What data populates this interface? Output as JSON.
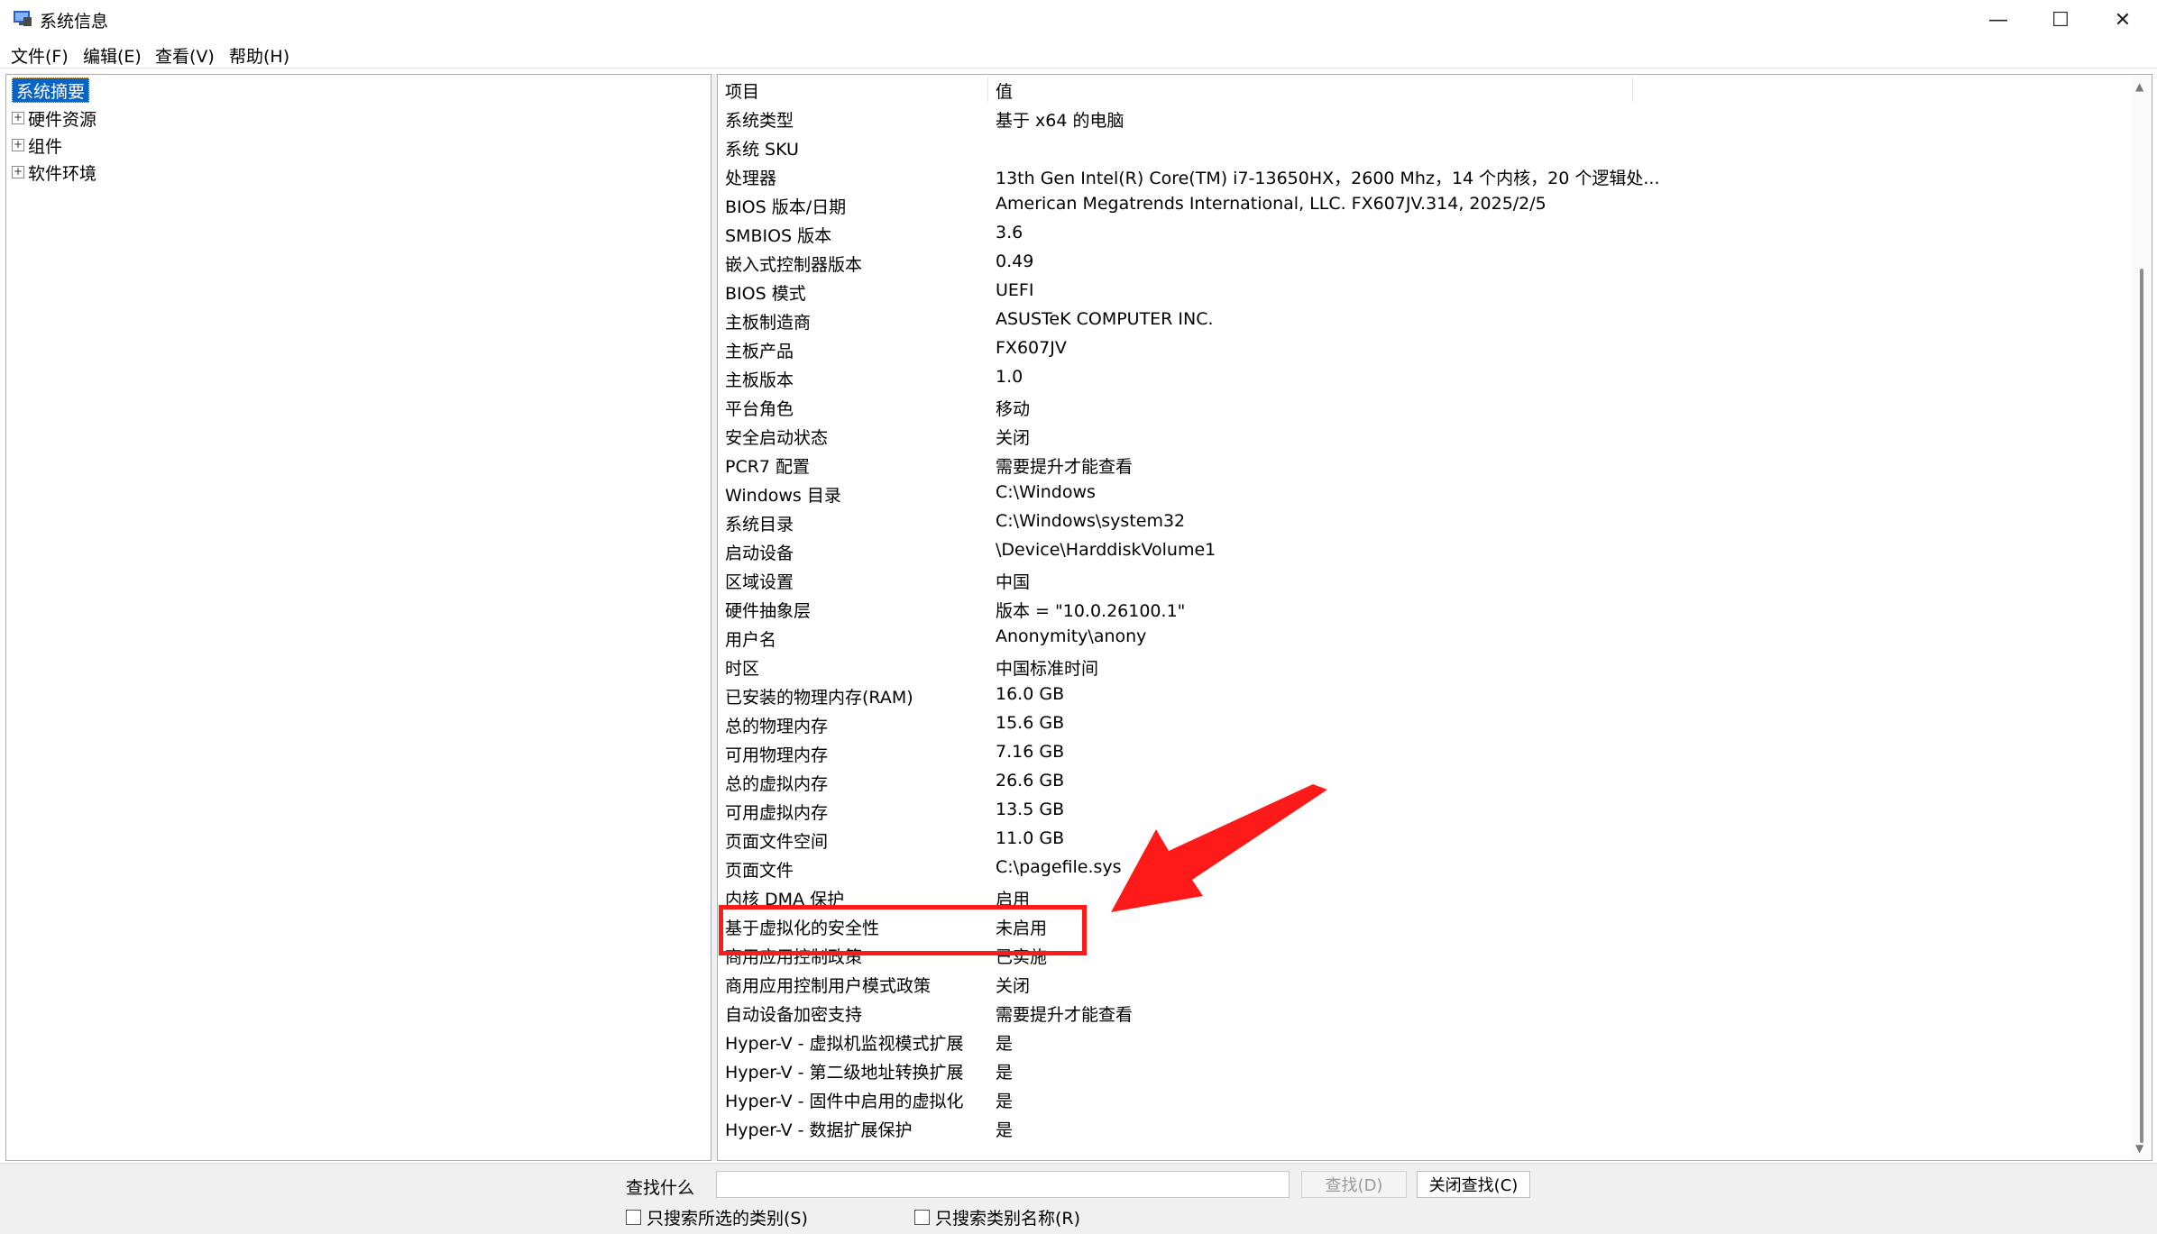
{
  "window": {
    "title": "系统信息",
    "controls": {
      "minimize": "—",
      "maximize": "☐",
      "close": "✕"
    }
  },
  "menu": [
    "文件(F)",
    "编辑(E)",
    "查看(V)",
    "帮助(H)"
  ],
  "tree": [
    {
      "label": "系统摘要",
      "selected": true,
      "expandable": false
    },
    {
      "label": "硬件资源",
      "selected": false,
      "expandable": true
    },
    {
      "label": "组件",
      "selected": false,
      "expandable": true
    },
    {
      "label": "软件环境",
      "selected": false,
      "expandable": true
    }
  ],
  "table": {
    "headers": {
      "key": "项目",
      "value": "值"
    },
    "rows": [
      {
        "key": "系统类型",
        "value": "基于 x64 的电脑"
      },
      {
        "key": "系统 SKU",
        "value": ""
      },
      {
        "key": "处理器",
        "value": "13th Gen Intel(R) Core(TM) i7-13650HX，2600 Mhz，14 个内核，20 个逻辑处..."
      },
      {
        "key": "BIOS 版本/日期",
        "value": "American Megatrends International, LLC. FX607JV.314, 2025/2/5"
      },
      {
        "key": "SMBIOS 版本",
        "value": "3.6"
      },
      {
        "key": "嵌入式控制器版本",
        "value": "0.49"
      },
      {
        "key": "BIOS 模式",
        "value": "UEFI"
      },
      {
        "key": "主板制造商",
        "value": "ASUSTeK COMPUTER INC."
      },
      {
        "key": "主板产品",
        "value": "FX607JV"
      },
      {
        "key": "主板版本",
        "value": "1.0"
      },
      {
        "key": "平台角色",
        "value": "移动"
      },
      {
        "key": "安全启动状态",
        "value": "关闭"
      },
      {
        "key": "PCR7 配置",
        "value": "需要提升才能查看"
      },
      {
        "key": "Windows 目录",
        "value": "C:\\Windows"
      },
      {
        "key": "系统目录",
        "value": "C:\\Windows\\system32"
      },
      {
        "key": "启动设备",
        "value": "\\Device\\HarddiskVolume1"
      },
      {
        "key": "区域设置",
        "value": "中国"
      },
      {
        "key": "硬件抽象层",
        "value": "版本 = \"10.0.26100.1\""
      },
      {
        "key": "用户名",
        "value": "Anonymity\\anony"
      },
      {
        "key": "时区",
        "value": "中国标准时间"
      },
      {
        "key": "已安装的物理内存(RAM)",
        "value": "16.0 GB"
      },
      {
        "key": "总的物理内存",
        "value": "15.6 GB"
      },
      {
        "key": "可用物理内存",
        "value": "7.16 GB"
      },
      {
        "key": "总的虚拟内存",
        "value": "26.6 GB"
      },
      {
        "key": "可用虚拟内存",
        "value": "13.5 GB"
      },
      {
        "key": "页面文件空间",
        "value": "11.0 GB"
      },
      {
        "key": "页面文件",
        "value": "C:\\pagefile.sys"
      },
      {
        "key": "内核 DMA 保护",
        "value": "启用"
      },
      {
        "key": "基于虚拟化的安全性",
        "value": "未启用"
      },
      {
        "key": "商用应用控制政策",
        "value": "已实施"
      },
      {
        "key": "商用应用控制用户模式政策",
        "value": "关闭"
      },
      {
        "key": "自动设备加密支持",
        "value": "需要提升才能查看"
      },
      {
        "key": "Hyper-V - 虚拟机监视模式扩展",
        "value": "是"
      },
      {
        "key": "Hyper-V - 第二级地址转换扩展",
        "value": "是"
      },
      {
        "key": "Hyper-V - 固件中启用的虚拟化",
        "value": "是"
      },
      {
        "key": "Hyper-V - 数据扩展保护",
        "value": "是"
      }
    ]
  },
  "find": {
    "label": "查找什么",
    "value": "",
    "find_button": "查找(D)",
    "close_find_button": "关闭查找(C)",
    "check_selected_category": "只搜索所选的类别(S)",
    "check_category_names": "只搜索类别名称(R)"
  },
  "colors": {
    "selection": "#0a64c8",
    "annotation": "#ff1a1a"
  }
}
